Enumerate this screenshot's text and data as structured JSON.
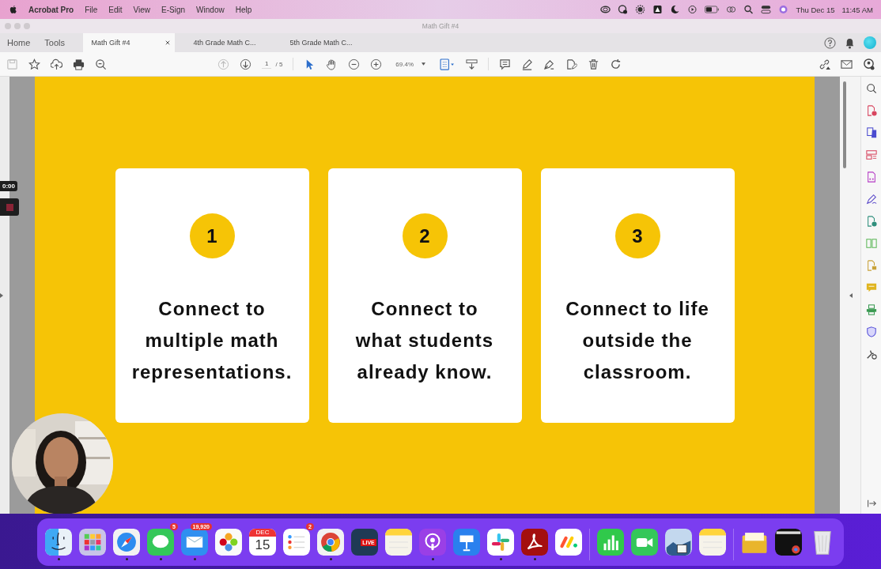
{
  "menu_bar": {
    "app": "Acrobat Pro",
    "items": [
      "File",
      "Edit",
      "View",
      "E-Sign",
      "Window",
      "Help"
    ],
    "date": "Thu Dec 15",
    "time": "11:45 AM"
  },
  "window": {
    "title": "Math Gift #4"
  },
  "nav": [
    "Home",
    "Tools"
  ],
  "tabs": [
    {
      "label": "Math Gift #4",
      "selected": true
    },
    {
      "label": "4th Grade Math C...",
      "selected": false
    },
    {
      "label": "5th Grade Math C...",
      "selected": false
    }
  ],
  "toolbar": {
    "page": "1",
    "pages": "/ 5",
    "zoom": "69.4%"
  },
  "recording": {
    "timer": "0:00"
  },
  "cards": [
    {
      "number": "1",
      "text": "Connect to\nmultiple math\nrepresentations."
    },
    {
      "number": "2",
      "text": "Connect to\nwhat students\nalready know."
    },
    {
      "number": "3",
      "text": "Connect to life\noutside the\nclassroom."
    }
  ],
  "webcam": {
    "kind": "picture"
  },
  "dock": [
    {
      "kind": "finder",
      "running": true
    },
    {
      "kind": "launchpad",
      "running": false
    },
    {
      "kind": "safari",
      "running": true
    },
    {
      "kind": "messages",
      "running": true,
      "badge": "5"
    },
    {
      "kind": "mail",
      "running": true,
      "badge": "19,920"
    },
    {
      "kind": "photos",
      "running": false
    },
    {
      "kind": "calendar",
      "running": false,
      "month": "DEC",
      "day": "15"
    },
    {
      "kind": "reminders",
      "running": false,
      "badge": "2"
    },
    {
      "kind": "chrome",
      "running": true
    },
    {
      "kind": "live",
      "running": false,
      "label": "LIVE"
    },
    {
      "kind": "notes",
      "running": false
    },
    {
      "kind": "podcasts",
      "running": true
    },
    {
      "kind": "keynote",
      "running": false
    },
    {
      "kind": "slack",
      "running": true
    },
    {
      "kind": "acrobat",
      "running": true
    },
    {
      "kind": "monday",
      "running": false
    },
    {
      "kind": "separator"
    },
    {
      "kind": "numbers",
      "running": false
    },
    {
      "kind": "facetime",
      "running": false
    },
    {
      "kind": "preview",
      "running": false
    },
    {
      "kind": "notes",
      "running": false
    },
    {
      "kind": "separator"
    },
    {
      "kind": "folder",
      "running": false
    },
    {
      "kind": "window",
      "running": false
    },
    {
      "kind": "trash",
      "running": false
    }
  ]
}
